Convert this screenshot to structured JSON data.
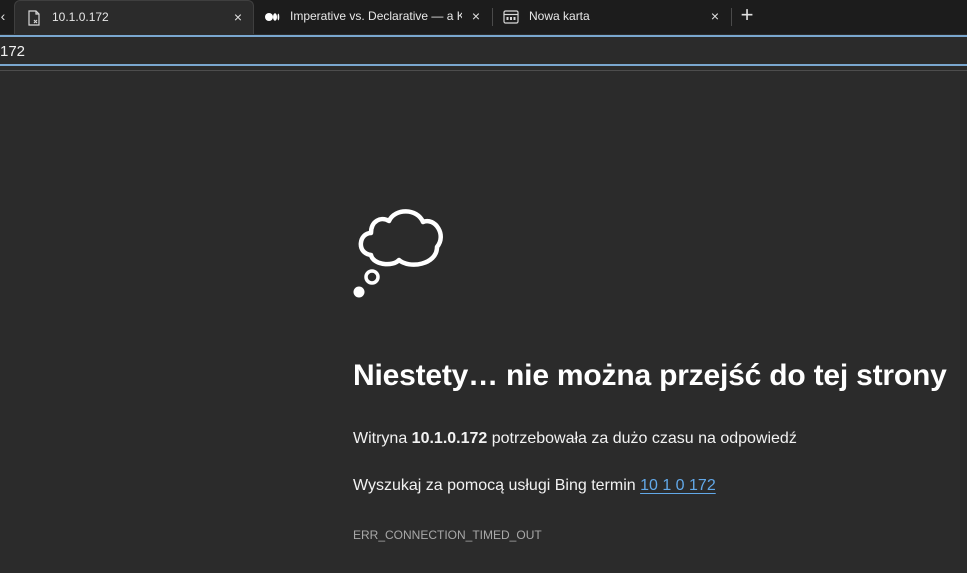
{
  "tabs": [
    {
      "title": "10.1.0.172",
      "icon": "page-error-icon",
      "active": true,
      "close": "×"
    },
    {
      "title": "Imperative vs. Declarative — a K",
      "icon": "medium-icon",
      "active": false,
      "close": "×"
    },
    {
      "title": "Nowa karta",
      "icon": "new-tab-page-icon",
      "active": false,
      "close": "×"
    }
  ],
  "tabstrip": {
    "scroll_left": "‹",
    "new_tab": "+"
  },
  "address_bar": {
    "value": "172"
  },
  "error": {
    "icon": "thought-cloud-icon",
    "heading": "Niestety… nie można przejść do tej strony",
    "line1_prefix": "Witryna ",
    "line1_host": "10.1.0.172",
    "line1_suffix": " potrzebowała za dużo czasu na odpowiedź",
    "line2_prefix": "Wyszukaj za pomocą usługi Bing termin ",
    "line2_link": "10 1 0 172",
    "code": "ERR_CONNECTION_TIMED_OUT"
  },
  "colors": {
    "background": "#2b2b2b",
    "tabstrip": "#1c1c1c",
    "link": "#62a8e8",
    "address_focus": "#7aa7cf"
  }
}
